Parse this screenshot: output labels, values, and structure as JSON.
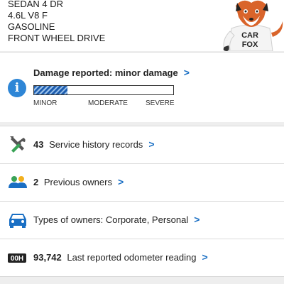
{
  "vehicle": {
    "specs": [
      "SEDAN 4 DR",
      "4.6L V8 F",
      "GASOLINE",
      "FRONT WHEEL DRIVE"
    ],
    "mascot_text": "CAR FOX"
  },
  "damage": {
    "title": "Damage reported: minor damage",
    "chevron": ">",
    "level_fraction": 0.24,
    "scale_labels": [
      "MINOR",
      "MODERATE",
      "SEVERE"
    ],
    "icon": "info-icon",
    "fill_color": "#1f5fb0"
  },
  "rows": [
    {
      "icon": "wrench-screwdriver-icon",
      "count": "43",
      "label": "Service history records",
      "chevron": ">"
    },
    {
      "icon": "people-icon",
      "count": "2",
      "label": "Previous owners",
      "chevron": ">"
    },
    {
      "icon": "car-icon",
      "count": "",
      "label": "Types of owners: Corporate, Personal",
      "chevron": ">"
    },
    {
      "icon": "odometer-icon",
      "count": "93,742",
      "label": "Last reported odometer reading",
      "chevron": ">"
    }
  ],
  "odometer_icon_text": "00H",
  "accent_color": "#1a6fc4"
}
